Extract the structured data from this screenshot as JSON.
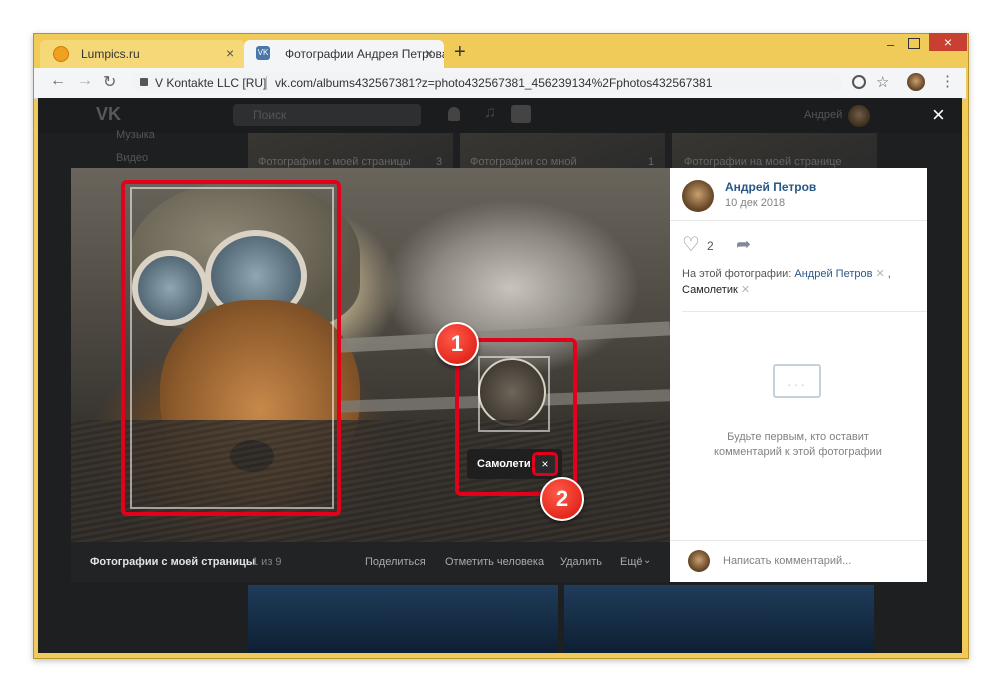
{
  "browser": {
    "tabs": [
      {
        "title": "Lumpics.ru",
        "close": "×"
      },
      {
        "title": "Фотографии Андрея Петрова –",
        "close": "×"
      }
    ],
    "new_tab": "+",
    "window_controls": {
      "minimize": "–",
      "maximize": "□",
      "close": "×"
    },
    "site_security": "V Kontakte LLC [RU]",
    "url": "vk.com/albums432567381?z=photo432567381_456239134%2Fphotos432567381"
  },
  "vk": {
    "search_placeholder": "Поиск",
    "user_name": "Андрей",
    "left_menu": [
      "Музыка",
      "Видео"
    ],
    "bg_albums": [
      "Фотографии с моей страницы",
      "Фотографии со мной",
      "Фотографии на моей странице"
    ],
    "bg_counts": [
      "3",
      "1"
    ]
  },
  "viewer": {
    "close": "×",
    "tag_label": "Самолети",
    "tag_remove": "×",
    "annotations": [
      "1",
      "2"
    ],
    "footer": {
      "album": "Фотографии с моей страницы",
      "counter": "1 из 9",
      "actions": [
        "Поделиться",
        "Отметить человека",
        "Удалить",
        "Ещё"
      ]
    }
  },
  "sidebar": {
    "author": "Андрей Петров",
    "date": "10 дек 2018",
    "likes": "2",
    "on_photo_prefix": "На этой фотографии:",
    "tags": [
      "Андрей Петров",
      "Самолетик"
    ],
    "empty_text": "Будьте первым, кто оставит комментарий к этой фотографии",
    "comment_placeholder": "Написать комментарий..."
  },
  "colors": {
    "accent": "#2a5885",
    "highlight": "#e3001b",
    "browser_frame": "#f1cb5a"
  }
}
